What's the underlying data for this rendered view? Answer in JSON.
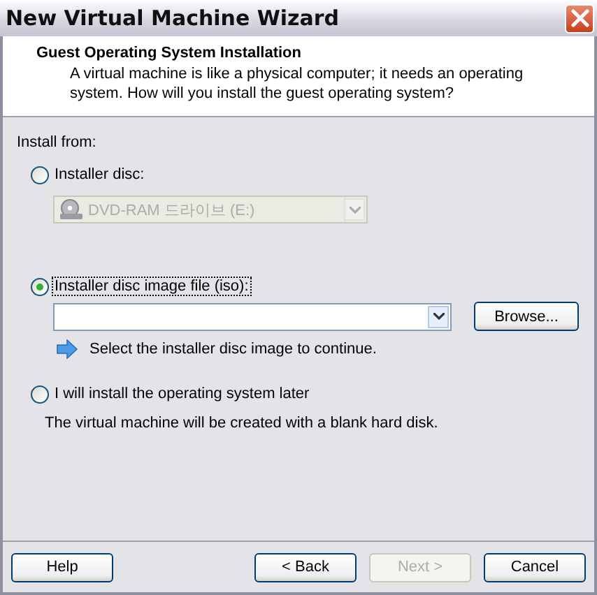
{
  "window": {
    "title": "New Virtual Machine Wizard"
  },
  "header": {
    "title": "Guest Operating System Installation",
    "description": "A virtual machine is like a physical computer; it needs an operating system. How will you install the guest operating system?"
  },
  "install_from_label": "Install from:",
  "options": [
    {
      "kind": "disc",
      "label": "Installer disc:",
      "selected": false,
      "focused": false,
      "drive": {
        "value": "DVD-RAM 드라이브 (E:)",
        "disabled": true
      }
    },
    {
      "kind": "iso",
      "label": "Installer disc image file (iso):",
      "selected": true,
      "focused": true,
      "browse": "Browse...",
      "hint": "Select the installer disc image to continue."
    },
    {
      "kind": "later",
      "label": "I will install the operating system later",
      "selected": false,
      "focused": false,
      "note": "The virtual machine will be created with a blank hard disk."
    }
  ],
  "buttons": [
    {
      "label": "Help",
      "disabled": false
    },
    {
      "label": "< Back",
      "disabled": false
    },
    {
      "label": "Next >",
      "disabled": true
    },
    {
      "label": "Cancel",
      "disabled": false
    }
  ]
}
